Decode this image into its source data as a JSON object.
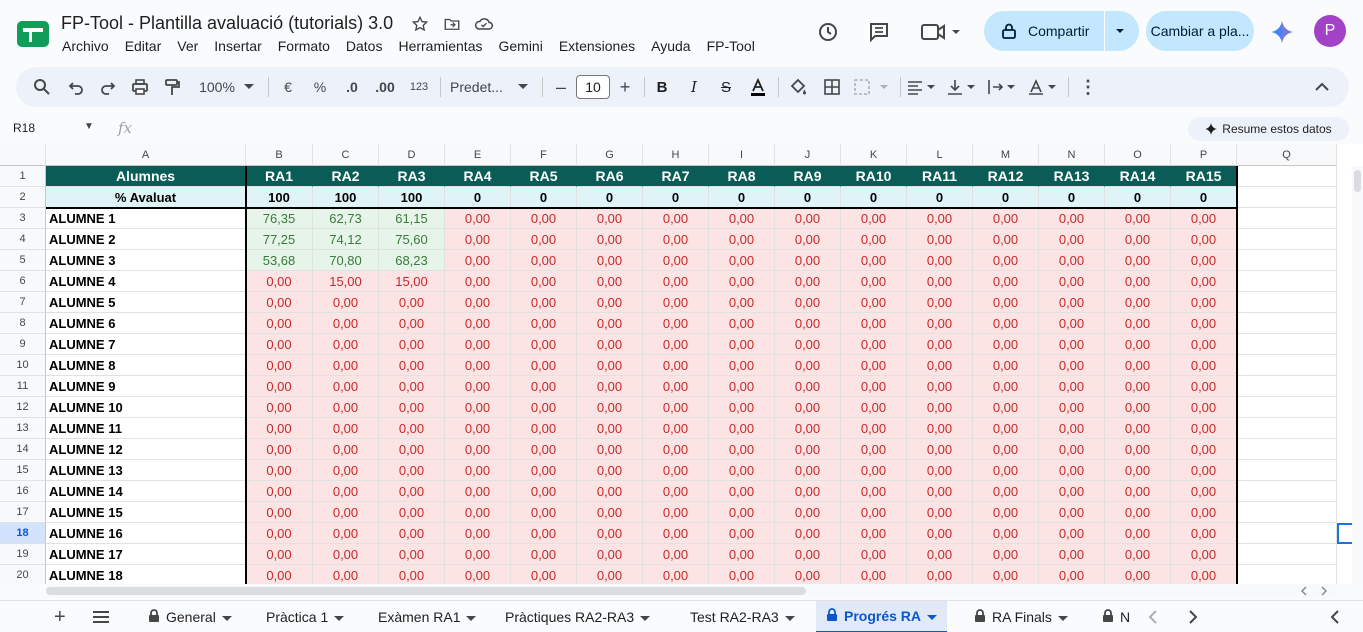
{
  "title": "FP-Tool - Plantilla avaluació (tutorials) 3.0",
  "menu": [
    "Archivo",
    "Editar",
    "Ver",
    "Insertar",
    "Formato",
    "Datos",
    "Herramientas",
    "Gemini",
    "Extensiones",
    "Ayuda",
    "FP-Tool"
  ],
  "share_label": "Compartir",
  "change_label": "Cambiar a pla...",
  "avatar_letter": "P",
  "toolbar": {
    "zoom": "100%",
    "currency": "€",
    "percent": "%",
    "dec_decrease": ".0",
    "dec_increase": ".00",
    "number_format": "123",
    "font": "Predet...",
    "font_size": "10"
  },
  "namebox": "R18",
  "fx": "fx",
  "summary_label": "Resume estos datos",
  "columns": [
    "A",
    "B",
    "C",
    "D",
    "E",
    "F",
    "G",
    "H",
    "I",
    "J",
    "K",
    "L",
    "M",
    "N",
    "O",
    "P",
    "Q"
  ],
  "header_row": [
    "Alumnes",
    "RA1",
    "RA2",
    "RA3",
    "RA4",
    "RA5",
    "RA6",
    "RA7",
    "RA8",
    "RA9",
    "RA10",
    "RA11",
    "RA12",
    "RA13",
    "RA14",
    "RA15"
  ],
  "percent_row": [
    "% Avaluat",
    "100",
    "100",
    "100",
    "0",
    "0",
    "0",
    "0",
    "0",
    "0",
    "0",
    "0",
    "0",
    "0",
    "0",
    "0"
  ],
  "students": [
    {
      "name": "ALUMNE 1",
      "values": [
        "76,35",
        "62,73",
        "61,15"
      ]
    },
    {
      "name": "ALUMNE 2",
      "values": [
        "77,25",
        "74,12",
        "75,60"
      ]
    },
    {
      "name": "ALUMNE 3",
      "values": [
        "53,68",
        "70,80",
        "68,23"
      ]
    },
    {
      "name": "ALUMNE 4",
      "values": [
        "0,00",
        "15,00",
        "15,00"
      ]
    },
    {
      "name": "ALUMNE 5",
      "values": [
        "0,00",
        "0,00",
        "0,00"
      ]
    },
    {
      "name": "ALUMNE 6",
      "values": [
        "0,00",
        "0,00",
        "0,00"
      ]
    },
    {
      "name": "ALUMNE 7",
      "values": [
        "0,00",
        "0,00",
        "0,00"
      ]
    },
    {
      "name": "ALUMNE 8",
      "values": [
        "0,00",
        "0,00",
        "0,00"
      ]
    },
    {
      "name": "ALUMNE 9",
      "values": [
        "0,00",
        "0,00",
        "0,00"
      ]
    },
    {
      "name": "ALUMNE 10",
      "values": [
        "0,00",
        "0,00",
        "0,00"
      ]
    },
    {
      "name": "ALUMNE 11",
      "values": [
        "0,00",
        "0,00",
        "0,00"
      ]
    },
    {
      "name": "ALUMNE 12",
      "values": [
        "0,00",
        "0,00",
        "0,00"
      ]
    },
    {
      "name": "ALUMNE 13",
      "values": [
        "0,00",
        "0,00",
        "0,00"
      ]
    },
    {
      "name": "ALUMNE 14",
      "values": [
        "0,00",
        "0,00",
        "0,00"
      ]
    },
    {
      "name": "ALUMNE 15",
      "values": [
        "0,00",
        "0,00",
        "0,00"
      ]
    },
    {
      "name": "ALUMNE 16",
      "values": [
        "0,00",
        "0,00",
        "0,00"
      ]
    },
    {
      "name": "ALUMNE 17",
      "values": [
        "0,00",
        "0,00",
        "0,00"
      ]
    },
    {
      "name": "ALUMNE 18",
      "values": [
        "0,00",
        "0,00",
        "0,00"
      ]
    }
  ],
  "zero_value": "0,00",
  "selected_row": 18,
  "tabs": [
    {
      "label": "General",
      "locked": true,
      "active": false
    },
    {
      "label": "Pràctica 1",
      "locked": false,
      "active": false
    },
    {
      "label": "Exàmen RA1",
      "locked": false,
      "active": false
    },
    {
      "label": "Pràctiques RA2-RA3",
      "locked": false,
      "active": false
    },
    {
      "label": "Test RA2-RA3",
      "locked": false,
      "active": false
    },
    {
      "label": "Progrés RA",
      "locked": true,
      "active": true
    },
    {
      "label": "RA Finals",
      "locked": true,
      "active": false
    },
    {
      "label": "N",
      "locked": true,
      "active": false
    }
  ],
  "colors": {
    "header_bg": "#0a5d56",
    "percent_bg": "#dff4f7",
    "good_bg": "#e6f4ea",
    "bad_bg": "#fde4e4",
    "accent": "#0b57d0"
  }
}
